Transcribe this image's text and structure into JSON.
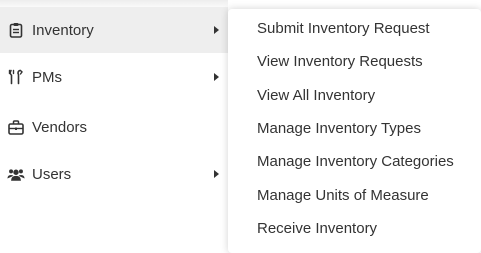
{
  "main_menu": {
    "items": [
      {
        "label": "Inventory",
        "icon": "clipboard-icon",
        "has_submenu": true,
        "active": true
      },
      {
        "label": "PMs",
        "icon": "wrench-icon",
        "has_submenu": true,
        "active": false
      },
      {
        "label": "Vendors",
        "icon": "briefcase-icon",
        "has_submenu": false,
        "active": false
      },
      {
        "label": "Users",
        "icon": "users-icon",
        "has_submenu": true,
        "active": false
      }
    ]
  },
  "submenu": {
    "items": [
      {
        "label": "Submit Inventory Request"
      },
      {
        "label": "View Inventory Requests"
      },
      {
        "label": "View All Inventory"
      },
      {
        "label": "Manage Inventory Types"
      },
      {
        "label": "Manage Inventory Categories"
      },
      {
        "label": "Manage Units of Measure"
      },
      {
        "label": "Receive Inventory"
      }
    ]
  },
  "colors": {
    "text": "#333333",
    "active_background": "#eeeeee",
    "panel_background": "#ffffff"
  }
}
